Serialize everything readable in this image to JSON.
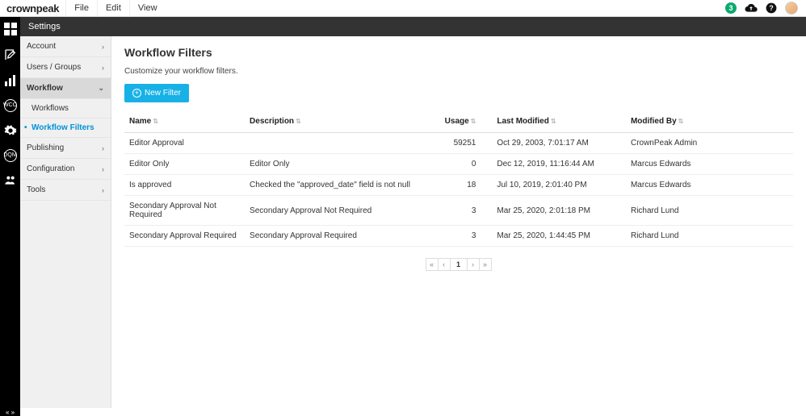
{
  "brand": "crownpeak",
  "menu": {
    "file": "File",
    "edit": "Edit",
    "view": "View"
  },
  "notifications": "3",
  "settings_header": "Settings",
  "sidebar": [
    {
      "label": "Account",
      "type": "item"
    },
    {
      "label": "Users / Groups",
      "type": "item"
    },
    {
      "label": "Workflow",
      "type": "item",
      "expanded": true
    },
    {
      "label": "Workflows",
      "type": "sub"
    },
    {
      "label": "Workflow Filters",
      "type": "sub",
      "active": true
    },
    {
      "label": "Publishing",
      "type": "item"
    },
    {
      "label": "Configuration",
      "type": "item"
    },
    {
      "label": "Tools",
      "type": "item"
    }
  ],
  "page": {
    "title": "Workflow Filters",
    "subtitle": "Customize your workflow filters.",
    "new_button": "New Filter"
  },
  "columns": {
    "name": "Name",
    "description": "Description",
    "usage": "Usage",
    "last_modified": "Last Modified",
    "modified_by": "Modified By"
  },
  "rows": [
    {
      "name": "Editor Approval",
      "description": "",
      "usage": "59251",
      "last_modified": "Oct 29, 2003, 7:01:17 AM",
      "modified_by": "CrownPeak Admin"
    },
    {
      "name": "Editor Only",
      "description": "Editor Only",
      "usage": "0",
      "last_modified": "Dec 12, 2019, 11:16:44 AM",
      "modified_by": "Marcus Edwards"
    },
    {
      "name": "Is approved",
      "description": "Checked the \"approved_date\" field is not null",
      "usage": "18",
      "last_modified": "Jul 10, 2019, 2:01:40 PM",
      "modified_by": "Marcus Edwards"
    },
    {
      "name": "Secondary Approval Not Required",
      "description": "Secondary Approval Not Required",
      "usage": "3",
      "last_modified": "Mar 25, 2020, 2:01:18 PM",
      "modified_by": "Richard Lund"
    },
    {
      "name": "Secondary Approval Required",
      "description": "Secondary Approval Required",
      "usage": "3",
      "last_modified": "Mar 25, 2020, 1:44:45 PM",
      "modified_by": "Richard Lund"
    }
  ],
  "pager": {
    "current": "1"
  },
  "rail_wco": "WCO",
  "rail_dqm": "DQM"
}
